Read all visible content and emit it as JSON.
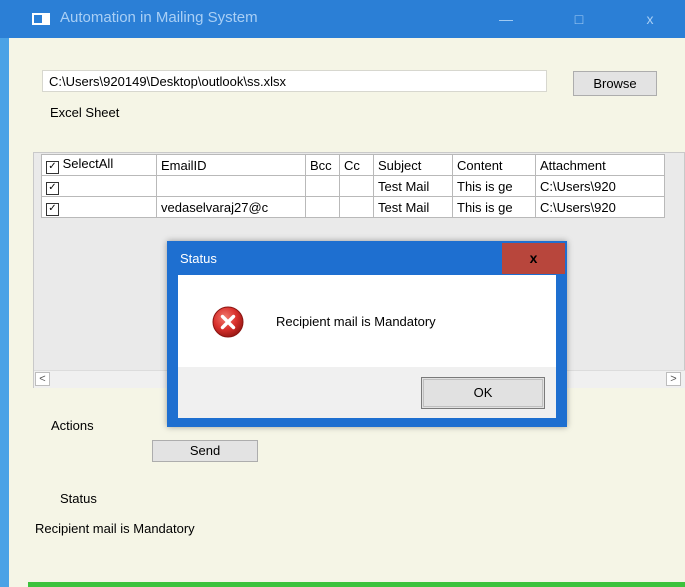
{
  "window": {
    "title": "Automation in Mailing System",
    "minimize_glyph": "—",
    "maximize_glyph": "□",
    "close_glyph": "x"
  },
  "file": {
    "path": "C:\\Users\\920149\\Desktop\\outlook\\ss.xlsx",
    "browse_label": "Browse",
    "excel_label": "Excel Sheet"
  },
  "grid": {
    "headers": {
      "select_all": "SelectAll",
      "email": "EmailID",
      "bcc": "Bcc",
      "cc": "Cc",
      "subject": "Subject",
      "content": "Content",
      "attachment": "Attachment"
    },
    "rows": [
      {
        "checked": true,
        "email": "",
        "bcc": "",
        "cc": "",
        "subject": "Test Mail",
        "content": "This is ge",
        "attachment": "C:\\Users\\920"
      },
      {
        "checked": true,
        "email": "vedaselvaraj27@c",
        "bcc": "",
        "cc": "",
        "subject": "Test Mail",
        "content": "This is ge",
        "attachment": "C:\\Users\\920"
      }
    ],
    "check_glyph": "✓",
    "scroll_left_glyph": "<",
    "scroll_right_glyph": ">"
  },
  "actions": {
    "label": "Actions",
    "send_label": "Send"
  },
  "status": {
    "label": "Status",
    "text": "Recipient mail is Mandatory"
  },
  "dialog": {
    "title": "Status",
    "close_glyph": "x",
    "message": "Recipient mail is Mandatory",
    "ok_label": "OK",
    "icon": "error-icon"
  },
  "colors": {
    "titlebar": "#2b7fd6",
    "window_bg": "#f5f5e6",
    "dialog_frame": "#1e6fd0",
    "dialog_close": "#b8463c",
    "error_red": "#d9302c"
  }
}
